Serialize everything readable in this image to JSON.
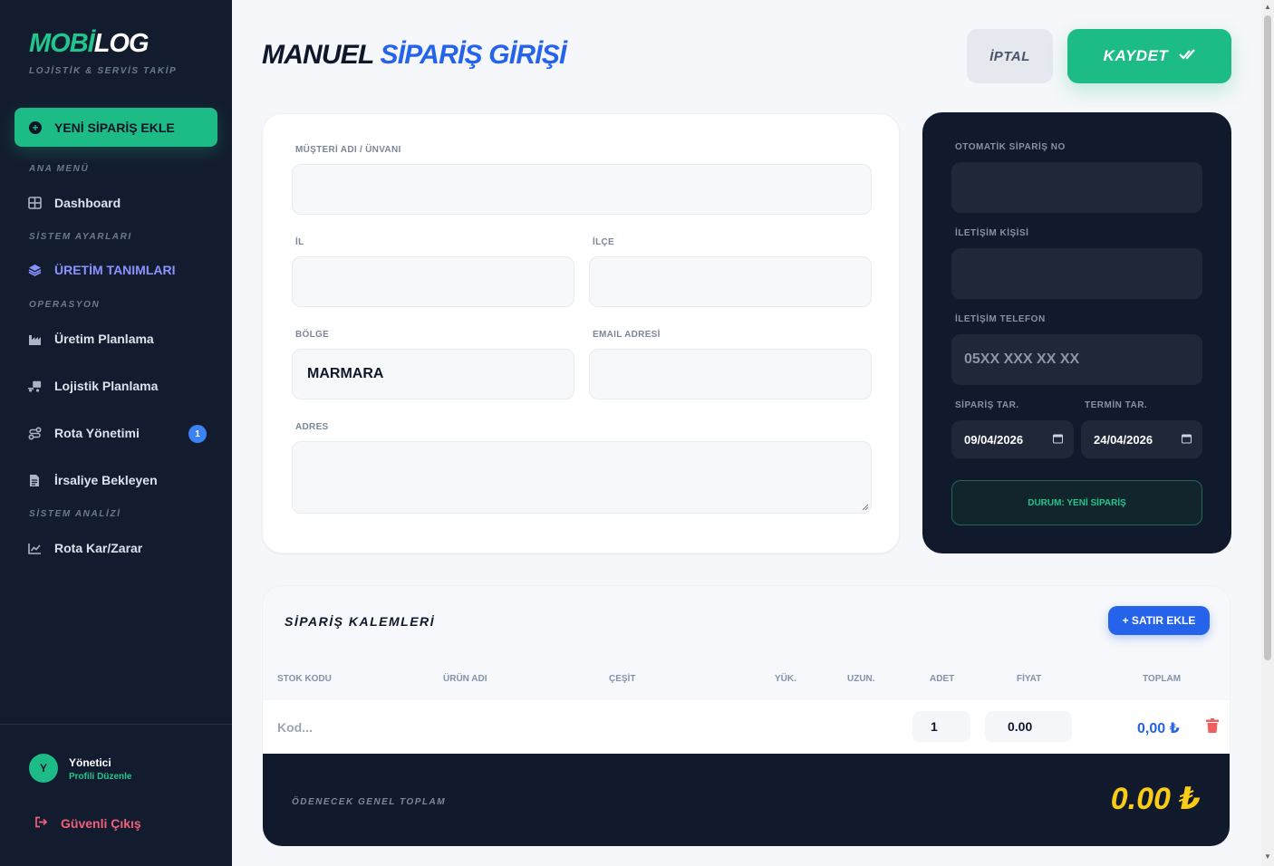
{
  "brand": {
    "logo_part1": "MOBİ",
    "logo_part2": "LOG",
    "subtitle": "LOJİSTİK & SERVİS TAKİP"
  },
  "sidebar": {
    "new_order": "YENİ SİPARİŞ EKLE",
    "sections": {
      "main": "ANA MENÜ",
      "settings": "SİSTEM AYARLARI",
      "operation": "OPERASYON",
      "analysis": "SİSTEM ANALİZİ"
    },
    "items": {
      "dashboard": "Dashboard",
      "production_defs": "ÜRETİM TANIMLARI",
      "production_plan": "Üretim Planlama",
      "logistics_plan": "Lojistik Planlama",
      "route_mgmt": "Rota Yönetimi",
      "waybill": "İrsaliye Bekleyen",
      "route_profit": "Rota Kar/Zarar"
    },
    "route_badge": "1",
    "user": {
      "initial": "Y",
      "name": "Yönetici",
      "edit": "Profili Düzenle"
    },
    "logout": "Güvenli Çıkış"
  },
  "header": {
    "title_part1": "MANUEL",
    "title_part2": "SİPARİŞ GİRİŞİ",
    "cancel": "İPTAL",
    "save": "KAYDET"
  },
  "form": {
    "customer_label": "MÜŞTERİ ADI / ÜNVANI",
    "customer_value": "",
    "city_label": "İL",
    "city_value": "",
    "district_label": "İLÇE",
    "district_value": "",
    "region_label": "BÖLGE",
    "region_value": "MARMARA",
    "email_label": "EMAIL ADRESİ",
    "email_value": "",
    "address_label": "ADRES",
    "address_value": ""
  },
  "side_panel": {
    "order_no_label": "OTOMATİK SİPARİŞ NO",
    "order_no_value": "",
    "contact_label": "İLETİŞİM KİŞİSİ",
    "contact_value": "",
    "phone_label": "İLETİŞİM TELEFON",
    "phone_placeholder": "05XX XXX XX XX",
    "order_date_label": "SİPARİŞ TAR.",
    "order_date_value": "09/04/2026",
    "due_date_label": "TERMİN TAR.",
    "due_date_value": "24/04/2026",
    "status": "DURUM: YENİ SİPARİŞ"
  },
  "items": {
    "title": "SİPARİŞ KALEMLERİ",
    "add_row": "+ SATIR EKLE",
    "columns": [
      "STOK KODU",
      "ÜRÜN ADI",
      "ÇEŞİT",
      "YÜK.",
      "UZUN.",
      "ADET",
      "FİYAT",
      "TOPLAM"
    ],
    "row": {
      "code_placeholder": "Kod...",
      "qty": "1",
      "price": "0.00",
      "total": "0,00 ₺"
    },
    "grand_total_label": "ÖDENECEK GENEL TOPLAM",
    "grand_total": "0.00 ₺"
  },
  "colors": {
    "accent_green": "#1dbb86",
    "accent_blue": "#2563eb",
    "sidebar_bg": "#131c2e",
    "total_yellow": "#facc15",
    "danger": "#ef5f5f"
  }
}
